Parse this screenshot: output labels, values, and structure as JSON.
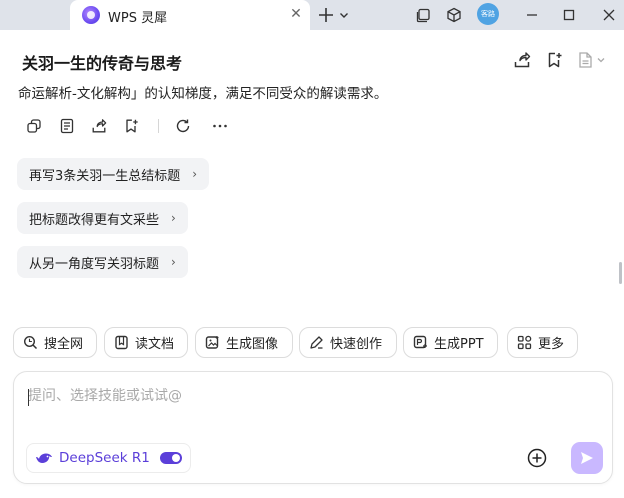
{
  "window": {
    "tab_title": "WPS 灵犀",
    "avatar_text": "客路"
  },
  "header": {
    "title": "关羽一生的传奇与思考"
  },
  "message": {
    "text": "命运解析-文化解构」的认知梯度，满足不同受众的解读需求。"
  },
  "suggestions": [
    {
      "label": "再写3条关羽一生总结标题"
    },
    {
      "label": "把标题改得更有文采些"
    },
    {
      "label": "从另一角度写关羽标题"
    }
  ],
  "tools": [
    {
      "label": "搜全网",
      "icon": "search-icon"
    },
    {
      "label": "读文档",
      "icon": "book-icon"
    },
    {
      "label": "生成图像",
      "icon": "image-icon"
    },
    {
      "label": "快速创作",
      "icon": "pen-icon"
    },
    {
      "label": "生成PPT",
      "icon": "ppt-icon"
    },
    {
      "label": "更多",
      "icon": "grid-icon"
    }
  ],
  "composer": {
    "placeholder": "提问、选择技能或试试@",
    "model_label": "DeepSeek R1",
    "model_enabled": true
  },
  "colors": {
    "accent": "#5b3fd9",
    "send_button": "#c9b8ff",
    "titlebar": "#dfe3ea",
    "chip_bg": "#f2f3f5"
  }
}
